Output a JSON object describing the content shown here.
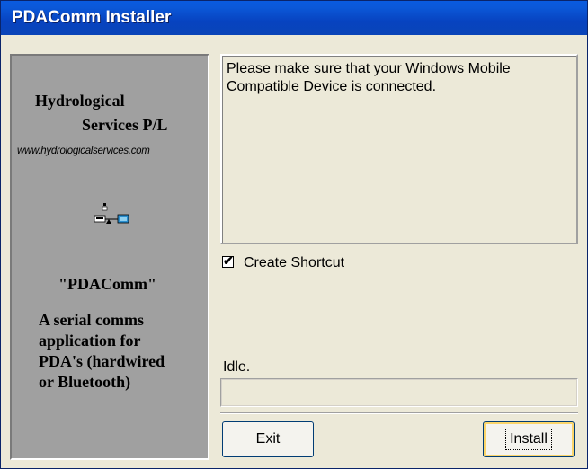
{
  "window": {
    "title": "PDAComm Installer"
  },
  "left_panel": {
    "company_line1": "Hydrological",
    "company_line2": "Services P/L",
    "website": "www.hydrologicalservices.com",
    "logo_icon": "device-link-icon",
    "app_name": "\"PDAComm\"",
    "description_lines": [
      "A serial comms",
      "application for",
      "PDA's (hardwired",
      "or Bluetooth)"
    ]
  },
  "message": "Please make sure that your Windows Mobile Compatible Device is connected.",
  "options": {
    "create_shortcut_label": "Create Shortcut",
    "create_shortcut_checked": true
  },
  "status_text": "Idle.",
  "progress": {
    "value": 0
  },
  "buttons": {
    "exit_label": "Exit",
    "install_label": "Install"
  },
  "colors": {
    "title_bar": "#0a5be0",
    "panel": "#a0a0a0",
    "background": "#ece9d8"
  }
}
